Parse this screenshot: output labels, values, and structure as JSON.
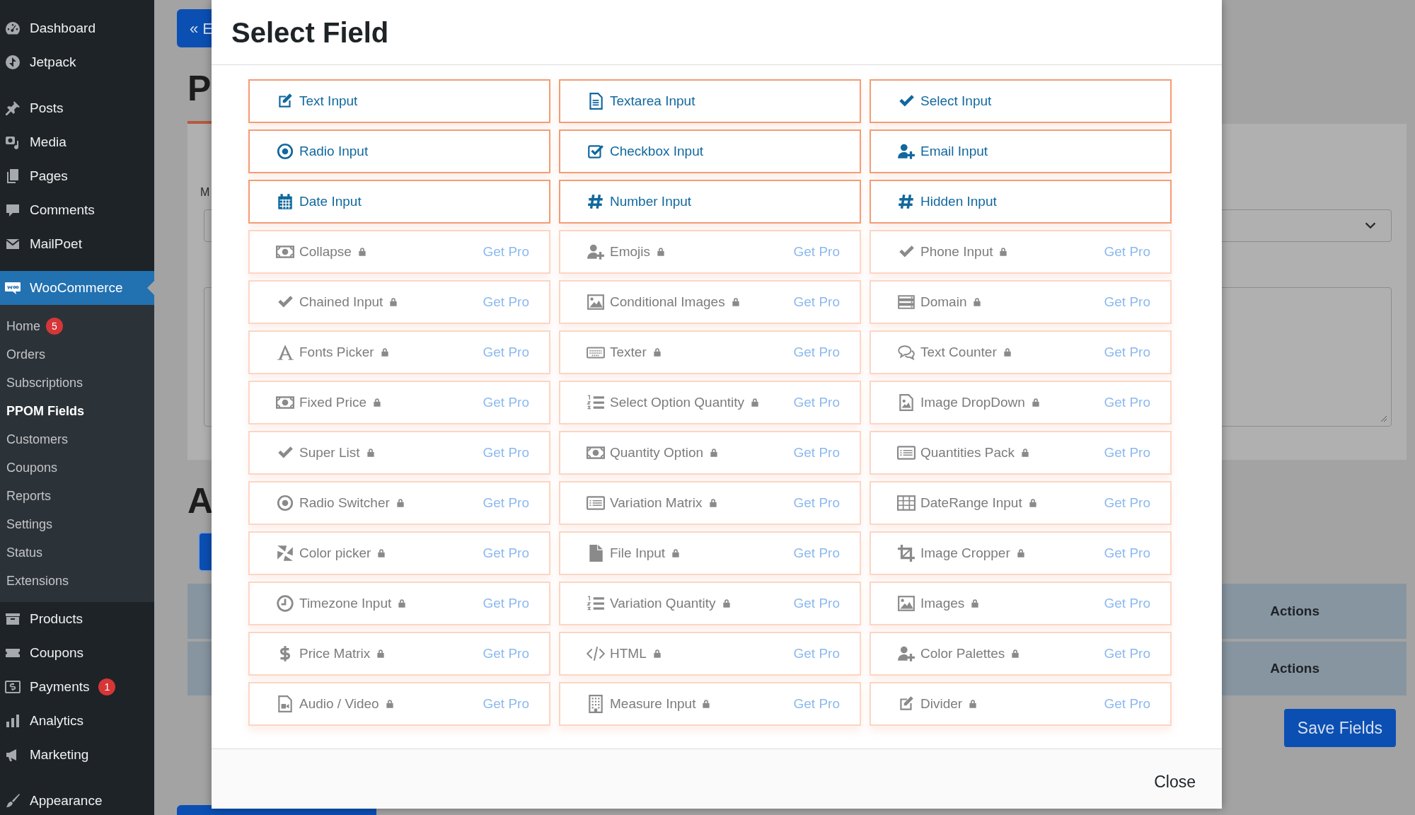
{
  "sidebar": {
    "sections": [
      {
        "items": [
          {
            "label": "Dashboard",
            "selected": false
          },
          {
            "label": "Jetpack",
            "selected": false
          }
        ]
      },
      {
        "items": [
          {
            "label": "Posts",
            "selected": false
          },
          {
            "label": "Media",
            "selected": false
          },
          {
            "label": "Pages",
            "selected": false
          },
          {
            "label": "Comments",
            "selected": false
          },
          {
            "label": "MailPoet",
            "selected": false
          },
          {
            "label": "WooCommerce",
            "selected": true,
            "children": [
              {
                "label": "Home",
                "badge": "5",
                "selected": false
              },
              {
                "label": "Orders",
                "selected": false
              },
              {
                "label": "Subscriptions",
                "selected": false
              },
              {
                "label": "PPOM Fields",
                "selected": true
              },
              {
                "label": "Customers",
                "selected": false
              },
              {
                "label": "Coupons",
                "selected": false
              },
              {
                "label": "Reports",
                "selected": false
              },
              {
                "label": "Settings",
                "selected": false
              },
              {
                "label": "Status",
                "selected": false
              },
              {
                "label": "Extensions",
                "selected": false
              }
            ]
          },
          {
            "label": "Products",
            "selected": false
          },
          {
            "label": "Coupons",
            "selected": false
          },
          {
            "label": "Payments",
            "badge": "1",
            "selected": false
          },
          {
            "label": "Analytics",
            "selected": false
          },
          {
            "label": "Marketing",
            "selected": false
          }
        ]
      },
      {
        "items": [
          {
            "label": "Appearance",
            "selected": false
          }
        ]
      }
    ]
  },
  "background": {
    "back_button": "« E",
    "heading": "P",
    "field_label": "M",
    "section_heading": "A",
    "table_header": "Actions",
    "table_footer": "Actions",
    "save_button": "Save Fields"
  },
  "modal": {
    "title": "Select Field",
    "close_button": "Close",
    "fields": [
      {
        "label": "Text Input",
        "locked": false
      },
      {
        "label": "Textarea Input",
        "locked": false
      },
      {
        "label": "Select Input",
        "locked": false
      },
      {
        "label": "Radio Input",
        "locked": false
      },
      {
        "label": "Checkbox Input",
        "locked": false
      },
      {
        "label": "Email Input",
        "locked": false
      },
      {
        "label": "Date Input",
        "locked": false
      },
      {
        "label": "Number Input",
        "locked": false
      },
      {
        "label": "Hidden Input",
        "locked": false
      },
      {
        "label": "Collapse",
        "locked": true,
        "action": "Get Pro"
      },
      {
        "label": "Emojis",
        "locked": true,
        "action": "Get Pro"
      },
      {
        "label": "Phone Input",
        "locked": true,
        "action": "Get Pro"
      },
      {
        "label": "Chained Input",
        "locked": true,
        "action": "Get Pro"
      },
      {
        "label": "Conditional Images",
        "locked": true,
        "action": "Get Pro"
      },
      {
        "label": "Domain",
        "locked": true,
        "action": "Get Pro"
      },
      {
        "label": "Fonts Picker",
        "locked": true,
        "action": "Get Pro"
      },
      {
        "label": "Texter",
        "locked": true,
        "action": "Get Pro"
      },
      {
        "label": "Text Counter",
        "locked": true,
        "action": "Get Pro"
      },
      {
        "label": "Fixed Price",
        "locked": true,
        "action": "Get Pro"
      },
      {
        "label": "Select Option Quantity",
        "locked": true,
        "action": "Get Pro"
      },
      {
        "label": "Image DropDown",
        "locked": true,
        "action": "Get Pro"
      },
      {
        "label": "Super List",
        "locked": true,
        "action": "Get Pro"
      },
      {
        "label": "Quantity Option",
        "locked": true,
        "action": "Get Pro"
      },
      {
        "label": "Quantities Pack",
        "locked": true,
        "action": "Get Pro"
      },
      {
        "label": "Radio Switcher",
        "locked": true,
        "action": "Get Pro"
      },
      {
        "label": "Variation Matrix",
        "locked": true,
        "action": "Get Pro"
      },
      {
        "label": "DateRange Input",
        "locked": true,
        "action": "Get Pro"
      },
      {
        "label": "Color picker",
        "locked": true,
        "action": "Get Pro"
      },
      {
        "label": "File Input",
        "locked": true,
        "action": "Get Pro"
      },
      {
        "label": "Image Cropper",
        "locked": true,
        "action": "Get Pro"
      },
      {
        "label": "Timezone Input",
        "locked": true,
        "action": "Get Pro"
      },
      {
        "label": "Variation Quantity",
        "locked": true,
        "action": "Get Pro"
      },
      {
        "label": "Images",
        "locked": true,
        "action": "Get Pro"
      },
      {
        "label": "Price Matrix",
        "locked": true,
        "action": "Get Pro"
      },
      {
        "label": "HTML",
        "locked": true,
        "action": "Get Pro"
      },
      {
        "label": "Color Palettes",
        "locked": true,
        "action": "Get Pro"
      },
      {
        "label": "Audio / Video",
        "locked": true,
        "action": "Get Pro"
      },
      {
        "label": "Measure Input",
        "locked": true,
        "action": "Get Pro"
      },
      {
        "label": "Divider",
        "locked": true,
        "action": "Get Pro"
      }
    ]
  }
}
